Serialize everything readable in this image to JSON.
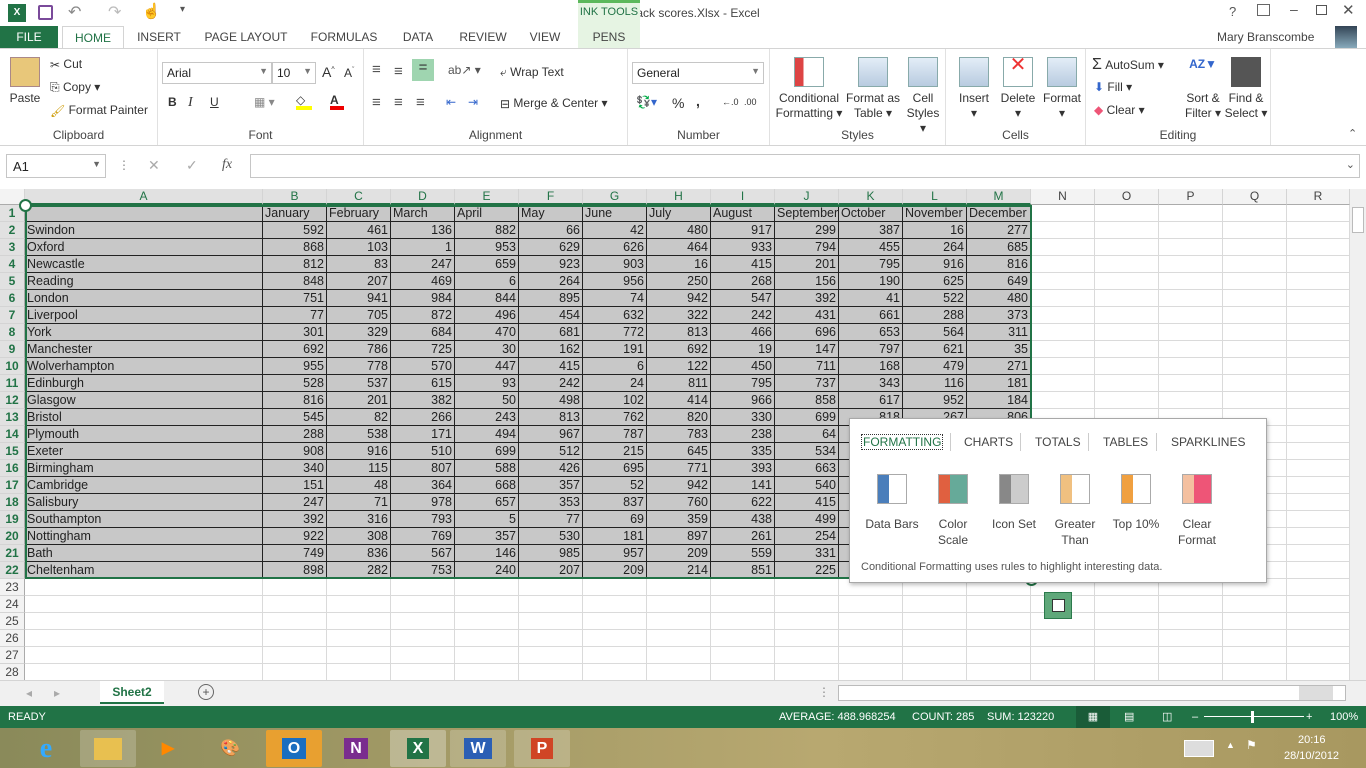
{
  "window": {
    "title": "feedback scores.Xlsx - Excel",
    "context_tab_group": "INK TOOLS",
    "user": "Mary Branscombe",
    "help": "?"
  },
  "ribbon_tabs": [
    "FILE",
    "HOME",
    "INSERT",
    "PAGE LAYOUT",
    "FORMULAS",
    "DATA",
    "REVIEW",
    "VIEW",
    "PENS"
  ],
  "clipboard": {
    "paste": "Paste",
    "cut": "Cut",
    "copy": "Copy",
    "format_painter": "Format Painter",
    "label": "Clipboard"
  },
  "font": {
    "name": "Arial",
    "size": "10",
    "bold": "B",
    "italic": "I",
    "underline": "U",
    "label": "Font"
  },
  "alignment": {
    "wrap": "Wrap Text",
    "merge": "Merge & Center",
    "label": "Alignment"
  },
  "number": {
    "format": "General",
    "percent": "%",
    "comma": ",",
    "label": "Number"
  },
  "styles": {
    "cond": [
      "Conditional",
      "Formatting ▾"
    ],
    "table": [
      "Format as",
      "Table ▾"
    ],
    "cell": [
      "Cell",
      "Styles ▾"
    ],
    "label": "Styles"
  },
  "cells": {
    "insert": "Insert",
    "delete": "Delete",
    "format": "Format",
    "label": "Cells"
  },
  "editing": {
    "autosum": "AutoSum",
    "fill": "Fill",
    "clear": "Clear",
    "sort": [
      "Sort &",
      "Filter ▾"
    ],
    "find": [
      "Find &",
      "Select ▾"
    ],
    "label": "Editing"
  },
  "formula_bar": {
    "name_box": "A1",
    "fx": "fx",
    "value": ""
  },
  "columns": [
    "A",
    "B",
    "C",
    "D",
    "E",
    "F",
    "G",
    "H",
    "I",
    "J",
    "K",
    "L",
    "M",
    "N",
    "O",
    "P",
    "Q",
    "R"
  ],
  "headers": [
    "",
    "January",
    "February",
    "March",
    "April",
    "May",
    "June",
    "July",
    "August",
    "September",
    "October",
    "November",
    "December"
  ],
  "rows": [
    [
      "Swindon",
      592,
      461,
      136,
      882,
      66,
      42,
      480,
      917,
      299,
      387,
      16,
      277
    ],
    [
      "Oxford",
      868,
      103,
      1,
      953,
      629,
      626,
      464,
      933,
      794,
      455,
      264,
      685
    ],
    [
      "Newcastle",
      812,
      83,
      247,
      659,
      923,
      903,
      16,
      415,
      201,
      795,
      916,
      816
    ],
    [
      "Reading",
      848,
      207,
      469,
      6,
      264,
      956,
      250,
      268,
      156,
      190,
      625,
      649
    ],
    [
      "London",
      751,
      941,
      984,
      844,
      895,
      74,
      942,
      547,
      392,
      41,
      522,
      480
    ],
    [
      "Liverpool",
      77,
      705,
      872,
      496,
      454,
      632,
      322,
      242,
      431,
      661,
      288,
      373
    ],
    [
      "York",
      301,
      329,
      684,
      470,
      681,
      772,
      813,
      466,
      696,
      653,
      564,
      311
    ],
    [
      "Manchester",
      692,
      786,
      725,
      30,
      162,
      191,
      692,
      19,
      147,
      797,
      621,
      35
    ],
    [
      "Wolverhampton",
      955,
      778,
      570,
      447,
      415,
      6,
      122,
      450,
      711,
      168,
      479,
      271
    ],
    [
      "Edinburgh",
      528,
      537,
      615,
      93,
      242,
      24,
      811,
      795,
      737,
      343,
      116,
      181
    ],
    [
      "Glasgow",
      816,
      201,
      382,
      50,
      498,
      102,
      414,
      966,
      858,
      617,
      952,
      184
    ],
    [
      "Bristol",
      545,
      82,
      266,
      243,
      813,
      762,
      820,
      330,
      699,
      818,
      267,
      806
    ],
    [
      "Plymouth",
      288,
      538,
      171,
      494,
      967,
      787,
      783,
      238,
      64,
      null,
      null,
      null
    ],
    [
      "Exeter",
      908,
      916,
      510,
      699,
      512,
      215,
      645,
      335,
      534,
      null,
      null,
      null
    ],
    [
      "Birmingham",
      340,
      115,
      807,
      588,
      426,
      695,
      771,
      393,
      663,
      null,
      null,
      null
    ],
    [
      "Cambridge",
      151,
      48,
      364,
      668,
      357,
      52,
      942,
      141,
      540,
      null,
      null,
      null
    ],
    [
      "Salisbury",
      247,
      71,
      978,
      657,
      353,
      837,
      760,
      622,
      415,
      null,
      null,
      null
    ],
    [
      "Southampton",
      392,
      316,
      793,
      5,
      77,
      69,
      359,
      438,
      499,
      null,
      null,
      null
    ],
    [
      "Nottingham",
      922,
      308,
      769,
      357,
      530,
      181,
      897,
      261,
      254,
      null,
      null,
      null
    ],
    [
      "Bath",
      749,
      836,
      567,
      146,
      985,
      957,
      209,
      559,
      331,
      null,
      null,
      null
    ],
    [
      "Cheltenham",
      898,
      282,
      753,
      240,
      207,
      209,
      214,
      851,
      225,
      null,
      null,
      null
    ]
  ],
  "quick_analysis": {
    "tabs": [
      "FORMATTING",
      "CHARTS",
      "TOTALS",
      "TABLES",
      "SPARKLINES"
    ],
    "active_tab": "FORMATTING",
    "items": [
      [
        "Data Bars",
        ""
      ],
      [
        "Color",
        "Scale"
      ],
      [
        "Icon Set",
        ""
      ],
      [
        "Greater",
        "Than"
      ],
      [
        "Top 10%",
        ""
      ],
      [
        "Clear",
        "Format"
      ]
    ],
    "description": "Conditional Formatting uses rules to highlight interesting data."
  },
  "sheets": [
    "Sheet2"
  ],
  "status": {
    "mode": "READY",
    "average": "AVERAGE: 488.968254",
    "count": "COUNT: 285",
    "sum": "SUM: 123220",
    "zoom": "100%"
  },
  "taskbar": {
    "apps": [
      "Internet Explorer",
      "File Explorer",
      "Video",
      "Paint",
      "Outlook",
      "OneNote",
      "Excel",
      "Word",
      "PowerPoint"
    ],
    "time": "20:16",
    "date": "28/10/2012"
  },
  "colors": {
    "accent": "#217346",
    "selection": "#c8c8c8"
  }
}
